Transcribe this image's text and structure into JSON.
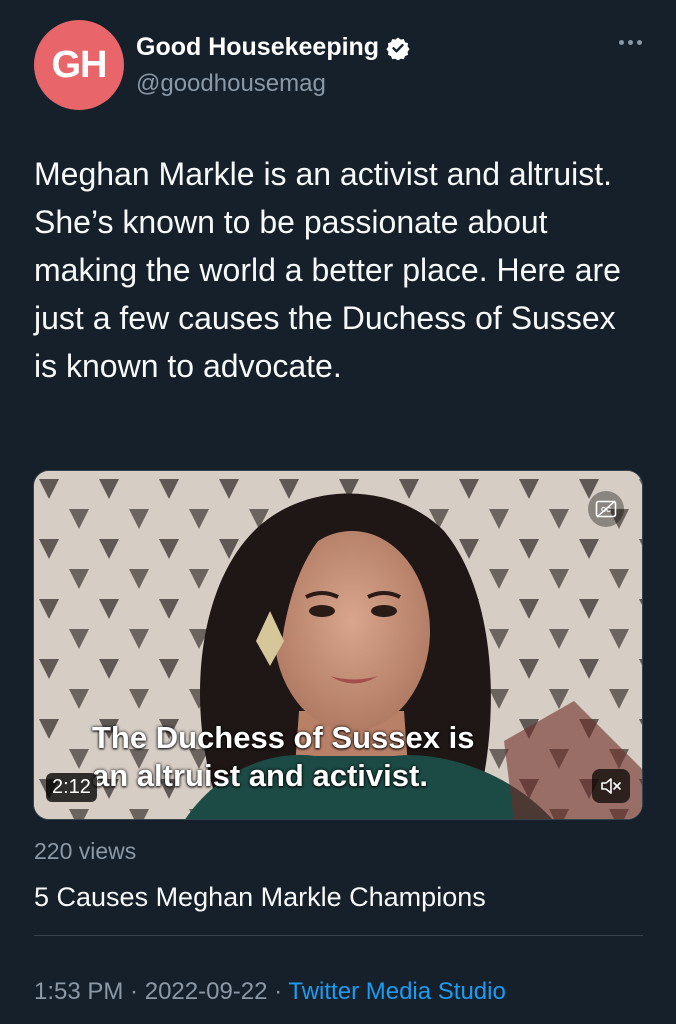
{
  "author": {
    "avatar_text": "GH",
    "display_name": "Good Housekeeping",
    "handle": "@goodhousemag",
    "verified": true
  },
  "tweet": {
    "text": "Meghan Markle is an activist and altruist. She’s known to be passionate about making the world a better place. Here are just a few causes the Duchess of Sussex is known to advocate."
  },
  "media": {
    "caption_line1": "The Duchess of Sussex is",
    "caption_line2": "an altruist and activist.",
    "duration": "2:12",
    "mute_icon": "speaker-muted-icon",
    "cc_icon": "closed-captions-icon"
  },
  "views": "220 views",
  "card_title": "5 Causes Meghan Markle Champions",
  "meta": {
    "time": "1:53 PM",
    "separator": " · ",
    "date": "2022-09-22",
    "source": "Twitter Media Studio"
  },
  "colors": {
    "background": "#15202b",
    "avatar": "#e8666a",
    "link": "#1d9bf0",
    "secondary_text": "#8b98a5"
  }
}
